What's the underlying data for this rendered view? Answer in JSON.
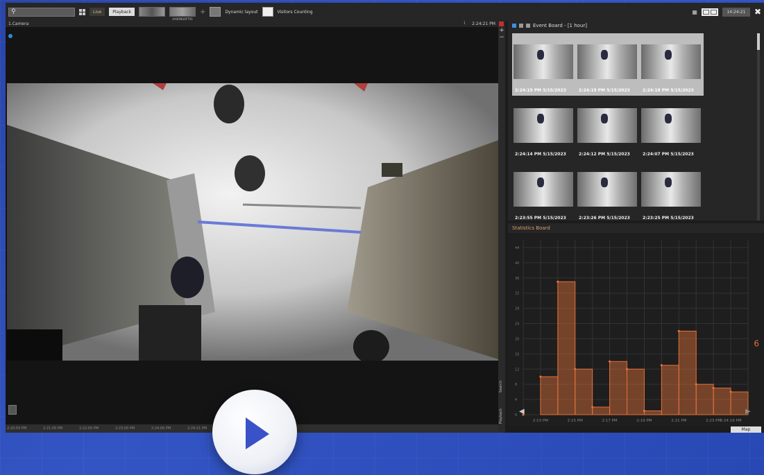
{
  "toolbar": {
    "live_label": "Live",
    "playback_label": "Playback",
    "thumb_caption": "AXXONSOFT01",
    "dynamic_layout_label": "Dynamic layout",
    "visitors_counting_label": "Visitors Counting",
    "clock": "14:24:21"
  },
  "camera": {
    "title": "1.Camera",
    "info": "i",
    "time": "2:24:21 PM",
    "timeline_ticks": [
      "2:20:50 PM",
      "2:21:00 PM",
      "2:22:00 PM",
      "2:23:00 PM",
      "2:24:00 PM",
      "2:24:21 PM"
    ],
    "search_tab": "Search",
    "playback_tab": "Playback"
  },
  "event_board": {
    "title": "Event Board - [1 hour]",
    "rows": [
      [
        "2:24:19 PM 5/15/2023",
        "2:24:19 PM 5/15/2023",
        "2:24:18 PM 5/15/2023"
      ],
      [
        "2:24:14 PM 5/15/2023",
        "2:24:12 PM 5/15/2023",
        "2:24:07 PM 5/15/2023"
      ],
      [
        "2:23:55 PM 5/15/2023",
        "2:23:26 PM 5/15/2023",
        "2:23:25 PM 5/15/2023"
      ]
    ]
  },
  "statistics_board": {
    "title": "Statistics Board",
    "current_value": "6",
    "map_label": "Map"
  },
  "chart_data": {
    "type": "area",
    "x": [
      "2:12 PM",
      "2:13 PM",
      "2:14 PM",
      "2:15 PM",
      "2:16 PM",
      "2:17 PM",
      "2:18 PM",
      "2:19 PM",
      "2:20 PM",
      "2:21 PM",
      "2:22 PM",
      "2:23 PM",
      "2:24 PM"
    ],
    "x_tick_labels": [
      "2:13 PM",
      "2:15 PM",
      "2:17 PM",
      "2:19 PM",
      "2:21 PM",
      "2:23 PM",
      "2:24:19 PM"
    ],
    "x_tick_index": [
      1,
      3,
      5,
      7,
      9,
      11,
      12
    ],
    "y_ticks": [
      "44",
      "40",
      "36",
      "32",
      "28",
      "24",
      "20",
      "16",
      "12",
      "8",
      "4",
      "0"
    ],
    "values": [
      0,
      10,
      35,
      12,
      2,
      14,
      12,
      1,
      13,
      22,
      8,
      7,
      6
    ],
    "ylim": [
      0,
      46
    ],
    "color": "#e0703a",
    "grid": true
  },
  "play_button": {
    "color": "#3a52c8"
  }
}
